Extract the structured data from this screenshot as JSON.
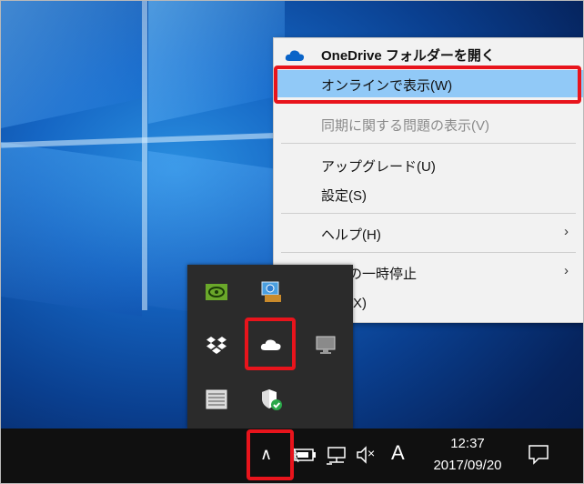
{
  "menu": {
    "items": [
      {
        "label": "OneDrive フォルダーを開く",
        "bold": true
      },
      {
        "label": "オンラインで表示(W)",
        "highlighted": true
      },
      {
        "label": "同期に関する問題の表示(V)",
        "disabled": true
      },
      {
        "label": "アップグレード(U)"
      },
      {
        "label": "設定(S)"
      },
      {
        "label": "ヘルプ(H)",
        "submenu_arrow": "›"
      },
      {
        "label": "同期の一時停止",
        "submenu_arrow": "›"
      },
      {
        "label": "終了(X)"
      }
    ]
  },
  "tray_popup": {
    "icons": [
      "nvidia-icon",
      "network-share-icon",
      "dropbox-icon",
      "onedrive-icon",
      "display-icon",
      "keyboard-icon",
      "security-shield-icon"
    ]
  },
  "taskbar": {
    "chevron": "∧",
    "ime_label": "A",
    "volume_mute_glyph": "×",
    "clock_time": "12:37",
    "clock_date": "2017/09/20"
  },
  "colors": {
    "highlight_red": "#e8141c",
    "menu_highlight": "#91c9f7",
    "onedrive_blue": "#0a64c8",
    "taskbar_bg": "#101010"
  }
}
